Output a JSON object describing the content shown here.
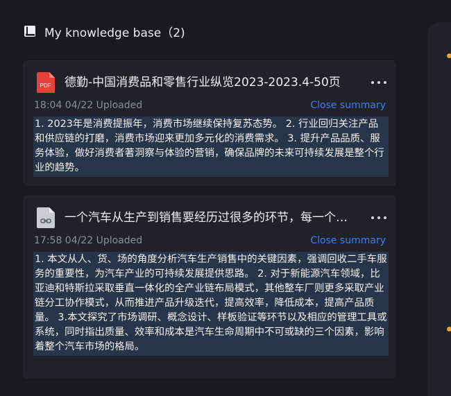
{
  "header": {
    "title": "My knowledge base（2)"
  },
  "documents": [
    {
      "icon": "pdf-file-icon",
      "icon_label": "PDF",
      "title": "德勤-中国消费品和零售行业纵览2023-2023.4-50页",
      "meta": "18:04 04/22 Uploaded",
      "close_label": "Close summary",
      "summary": "1. 2023年是消费提振年，消费市场继续保持复苏态势。 2. 行业回归关注产品和供应链的打磨，消费市场迎来更加多元化的消费需求。 3. 提升产品品质、服务体验，做好消费者著洞察与体验的营销，确保品牌的未来可持续发展是整个行业的趋势。"
    },
    {
      "icon": "link-file-icon",
      "title": "一个汽车从生产到销售要经历过很多的环节，每一个环节都需要",
      "meta": "17:58 04/22 Uploaded",
      "close_label": "Close summary",
      "summary": "1. 本文从人、货、场的角度分析汽车生产销售中的关键因素，强调回收二手车服务的重要性，为汽车产业的可持续发展提供思路。 2. 对于新能源汽车领域，比亚迪和特斯拉采取垂直一体化的全产业链布局模式，其他整车厂则更多采取产业链分工协作模式，从而推进产品升级迭代，提高效率，降低成本，提高产品质量。 3.本文探究了市场调研、概念设计、样板验证等环节以及相应的管理工具或系统，同时指出质量、效率和成本是汽车生命周期中不可或缺的三个因素，影响着整个汽车市场的格局。"
    }
  ],
  "colors": {
    "accent": "#3e7df0",
    "pdf_red": "#e5413b",
    "summary_bg": "#283447",
    "status_dot": "#f0a020"
  }
}
